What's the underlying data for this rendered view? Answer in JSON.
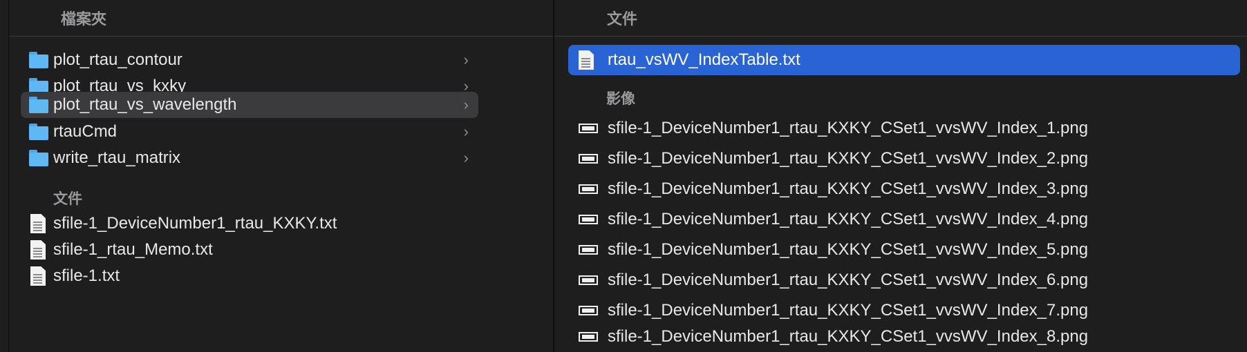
{
  "left": {
    "header": "檔案夾",
    "folders": [
      {
        "name": "plot_rtau_contour"
      },
      {
        "name": "plot_rtau_vs_kxky"
      },
      {
        "name": "plot_rtau_vs_wavelength"
      },
      {
        "name": "rtauCmd"
      },
      {
        "name": "write_rtau_matrix"
      }
    ],
    "files_section": "文件",
    "files": [
      {
        "name": "sfile-1_DeviceNumber1_rtau_KXKY.txt"
      },
      {
        "name": "sfile-1_rtau_Memo.txt"
      },
      {
        "name": "sfile-1.txt"
      }
    ],
    "selected_folder": "plot_rtau_vs_wavelength"
  },
  "right": {
    "header": "文件",
    "documents": [
      {
        "name": "rtau_vsWV_IndexTable.txt"
      }
    ],
    "images_section": "影像",
    "images": [
      {
        "name": "sfile-1_DeviceNumber1_rtau_KXKY_CSet1_vvsWV_Index_1.png"
      },
      {
        "name": "sfile-1_DeviceNumber1_rtau_KXKY_CSet1_vvsWV_Index_2.png"
      },
      {
        "name": "sfile-1_DeviceNumber1_rtau_KXKY_CSet1_vvsWV_Index_3.png"
      },
      {
        "name": "sfile-1_DeviceNumber1_rtau_KXKY_CSet1_vvsWV_Index_4.png"
      },
      {
        "name": "sfile-1_DeviceNumber1_rtau_KXKY_CSet1_vvsWV_Index_5.png"
      },
      {
        "name": "sfile-1_DeviceNumber1_rtau_KXKY_CSet1_vvsWV_Index_6.png"
      },
      {
        "name": "sfile-1_DeviceNumber1_rtau_KXKY_CSet1_vvsWV_Index_7.png"
      },
      {
        "name": "sfile-1_DeviceNumber1_rtau_KXKY_CSet1_vvsWV_Index_8.png"
      }
    ]
  },
  "colors": {
    "background": "#1e1e1f",
    "selection_gray": "#3b3b3d",
    "selection_blue": "#2a63d4",
    "folder": "#5fb8f3"
  },
  "icons": {
    "folder": "folder-icon",
    "document": "text-document-icon",
    "image": "image-file-icon",
    "chevron": "chevron-right-icon"
  }
}
